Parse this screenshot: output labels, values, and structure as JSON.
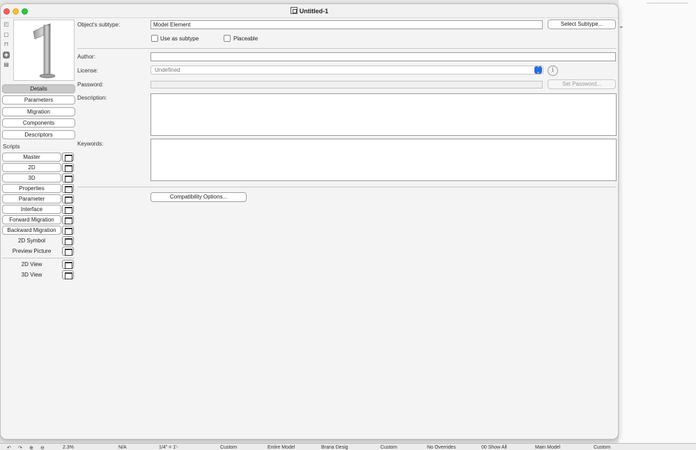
{
  "window": {
    "title": "Untitled-1"
  },
  "nav": {
    "details": "Details",
    "parameters": "Parameters",
    "migration": "Migration",
    "components": "Components",
    "descriptors": "Descriptors"
  },
  "scripts": {
    "heading": "Scripts",
    "items": [
      "Master",
      "2D",
      "3D",
      "Properties",
      "Parameter",
      "Interface",
      "Forward Migration",
      "Backward Migration",
      "2D Symbol",
      "Preview Picture",
      "2D View",
      "3D View"
    ]
  },
  "form": {
    "subtype_label": "Object's subtype:",
    "subtype_value": "Model Element",
    "select_subtype_button": "Select Subtype...",
    "use_as_subtype_label": "Use as subtype",
    "use_as_subtype_checked": false,
    "placeable_label": "Placeable",
    "placeable_checked": false,
    "author_label": "Author:",
    "author_value": "",
    "license_label": "License:",
    "license_value": "Undefined",
    "password_label": "Password:",
    "password_value": "",
    "set_password_button": "Set Password...",
    "description_label": "Description:",
    "description_value": "",
    "keywords_label": "Keywords:",
    "keywords_value": "",
    "compatibility_button": "Compatibility Options..."
  },
  "statusbar": {
    "zoom": "2.3%",
    "na": "N/A",
    "scale": "1/4\"  =  1'-",
    "custom1": "Custom",
    "entire_model": "Entire Model",
    "brana_design": "Brana Desig",
    "custom2": "Custom",
    "no_overrides": "No Overrides",
    "show_all": "00 Show All",
    "main_model": "Main Model",
    "custom3": "Custom"
  }
}
